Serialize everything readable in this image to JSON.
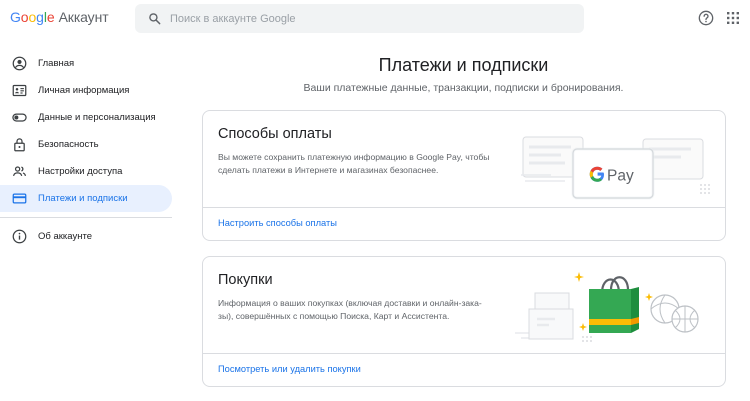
{
  "header": {
    "logo_letters": [
      "G",
      "o",
      "o",
      "g",
      "l",
      "e"
    ],
    "logo_suffix": "Аккаунт",
    "search_placeholder": "Поиск в аккаунте Google",
    "search_value": ""
  },
  "sidebar": {
    "items": [
      {
        "label": "Главная",
        "icon": "account-circle-icon"
      },
      {
        "label": "Личная информация",
        "icon": "id-card-icon"
      },
      {
        "label": "Данные и персонализация",
        "icon": "toggle-icon"
      },
      {
        "label": "Безопасность",
        "icon": "lock-icon"
      },
      {
        "label": "Настройки доступа",
        "icon": "people-icon"
      },
      {
        "label": "Платежи и подписки",
        "icon": "credit-card-icon",
        "active": true
      }
    ],
    "footer_items": [
      {
        "label": "Об аккаунте",
        "icon": "info-icon"
      }
    ]
  },
  "main": {
    "title": "Платежи и подписки",
    "subtitle": "Ваши платежные данные, транзакции, подписки и бронирования.",
    "cards": [
      {
        "title": "Способы оплаты",
        "description_lines": [
          "Вы можете сохранить платежную информацию в Google Pay, чтобы",
          "сделать платежи в Интернете и магазинах безопаснее."
        ],
        "link": "Настроить способы оплаты",
        "illustration": "google-pay-card",
        "illustration_text": "Pay"
      },
      {
        "title": "Покупки",
        "description_lines": [
          "Информация о ваших покупках (включая доставки и онлайн-зака-",
          "зы), совершённых с помощью Поиска, Карт и Ассистента."
        ],
        "link": "Посмотреть или удалить покупки",
        "illustration": "shopping-bag"
      }
    ]
  },
  "colors": {
    "accent": "#1a73e8",
    "active_bg": "#e8f0fe",
    "bag_green": "#34A853",
    "bag_stripe": "#FBBC05"
  }
}
